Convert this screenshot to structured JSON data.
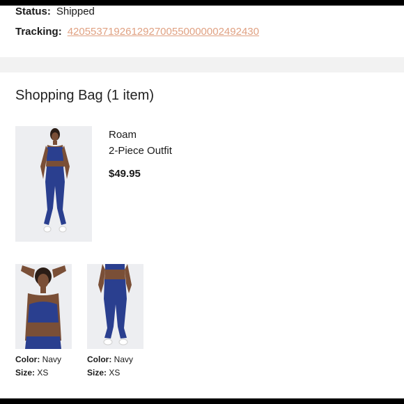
{
  "order": {
    "status_label": "Status:",
    "status_value": "Shipped",
    "tracking_label": "Tracking:",
    "tracking_number": "420553719261292700550000002492430"
  },
  "bag": {
    "title": "Shopping Bag (1 item)"
  },
  "product": {
    "brand": "Roam",
    "name": "2-Piece Outfit",
    "price": "$49.95"
  },
  "items": [
    {
      "color_label": "Color:",
      "color_value": "Navy",
      "size_label": "Size:",
      "size_value": "XS"
    },
    {
      "color_label": "Color:",
      "color_value": "Navy",
      "size_label": "Size:",
      "size_value": "XS"
    }
  ],
  "colors": {
    "link": "#e0a182",
    "garment": "#2a3f8f",
    "divider": "#f2f2f2"
  }
}
